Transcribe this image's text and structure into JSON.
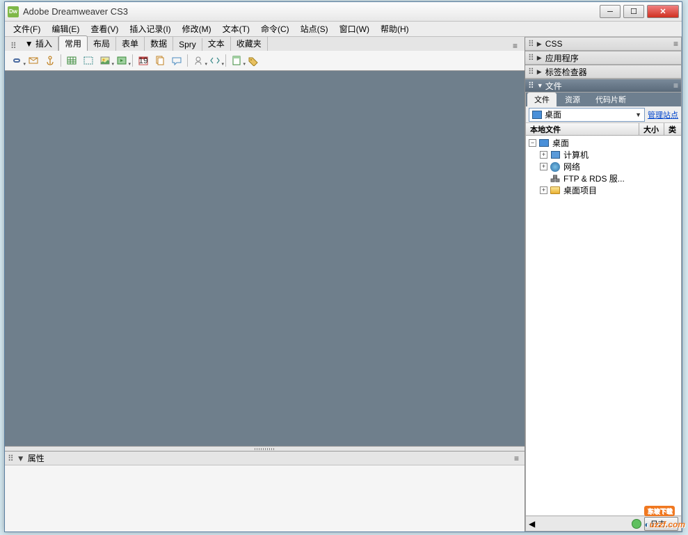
{
  "title": "Adobe Dreamweaver CS3",
  "app_icon_text": "Dw",
  "menubar": [
    "文件(F)",
    "编辑(E)",
    "查看(V)",
    "插入记录(I)",
    "修改(M)",
    "文本(T)",
    "命令(C)",
    "站点(S)",
    "窗口(W)",
    "帮助(H)"
  ],
  "insert": {
    "label": "▼ 插入",
    "tabs": [
      "常用",
      "布局",
      "表单",
      "数据",
      "Spry",
      "文本",
      "收藏夹"
    ],
    "active_tab": 0
  },
  "props": {
    "label": "属性"
  },
  "right_panels": {
    "css": "CSS",
    "apps": "应用程序",
    "tags": "标签检查器",
    "files": "文件"
  },
  "files_panel": {
    "tabs": [
      "文件",
      "资源",
      "代码片断"
    ],
    "active_tab": 0,
    "site_selected": "桌面",
    "manage_link": "管理站点",
    "columns": {
      "c1": "本地文件",
      "c2": "大小",
      "c3": "类"
    },
    "tree": {
      "root": "桌面",
      "items": [
        {
          "name": "计算机",
          "expandable": true
        },
        {
          "name": "网络",
          "expandable": true
        },
        {
          "name": "FTP & RDS 服...",
          "expandable": false
        },
        {
          "name": "桌面项目",
          "expandable": true
        }
      ]
    },
    "log_button": "日志..."
  },
  "watermark": {
    "badge": "东坡下载",
    "text": "uzzf.com"
  }
}
